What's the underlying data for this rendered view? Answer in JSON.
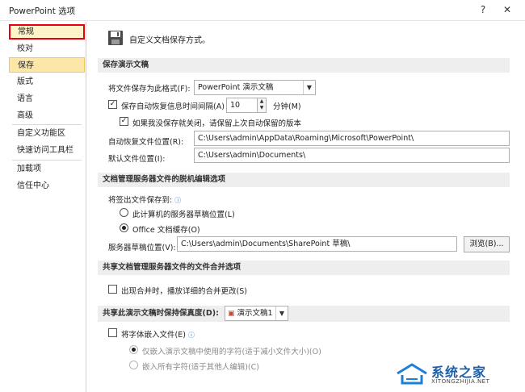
{
  "window": {
    "title": "PowerPoint 选项",
    "help": "?",
    "close": "✕"
  },
  "sidebar": {
    "items": [
      {
        "label": "常规"
      },
      {
        "label": "校对"
      },
      {
        "label": "保存"
      },
      {
        "label": "版式"
      },
      {
        "label": "语言"
      },
      {
        "label": "高级"
      },
      {
        "label": "自定义功能区"
      },
      {
        "label": "快速访问工具栏"
      },
      {
        "label": "加载项"
      },
      {
        "label": "信任中心"
      }
    ]
  },
  "main": {
    "header": "自定义文档保存方式。",
    "sections": {
      "save_presentation": "保存演示文稿",
      "offline_editing": "文档管理服务器文件的脱机编辑选项",
      "merge": "共享文档管理服务器文件的文件合并选项",
      "fidelity": "共享此演示文稿时保持保真度(D):"
    },
    "save": {
      "format_label": "将文件保存为此格式(F):",
      "format_value": "PowerPoint 演示文稿",
      "autorecover_label": "保存自动恢复信息时间间隔(A)",
      "autorecover_value": "10",
      "minutes_label": "分钟(M)",
      "keep_last_label": "如果我没保存就关闭，请保留上次自动保留的版本",
      "autorecover_location_label": "自动恢复文件位置(R):",
      "autorecover_location_value": "C:\\Users\\admin\\AppData\\Roaming\\Microsoft\\PowerPoint\\",
      "default_location_label": "默认文件位置(I):",
      "default_location_value": "C:\\Users\\admin\\Documents\\"
    },
    "offline": {
      "save_checked_out_label": "将签出文件保存到:",
      "radio_server_label": "此计算机的服务器草稿位置(L)",
      "radio_office_label": "Office 文档缓存(O)",
      "drafts_location_label": "服务器草稿位置(V):",
      "drafts_location_value": "C:\\Users\\admin\\Documents\\SharePoint 草稿\\",
      "browse_label": "浏览(B)..."
    },
    "merge": {
      "show_details_label": "出现合并时，播放详细的合并更改(S)"
    },
    "fidelity": {
      "presentation_value": "演示文稿1",
      "embed_fonts_label": "将字体嵌入文件(E)",
      "embed_used_label": "仅嵌入演示文稿中使用的字符(适于减小文件大小)(O)",
      "embed_all_label": "嵌入所有字符(适于其他人编辑)(C)"
    }
  },
  "watermark": {
    "name": "系统之家",
    "url": "XITONGZHIJIA.NET"
  }
}
